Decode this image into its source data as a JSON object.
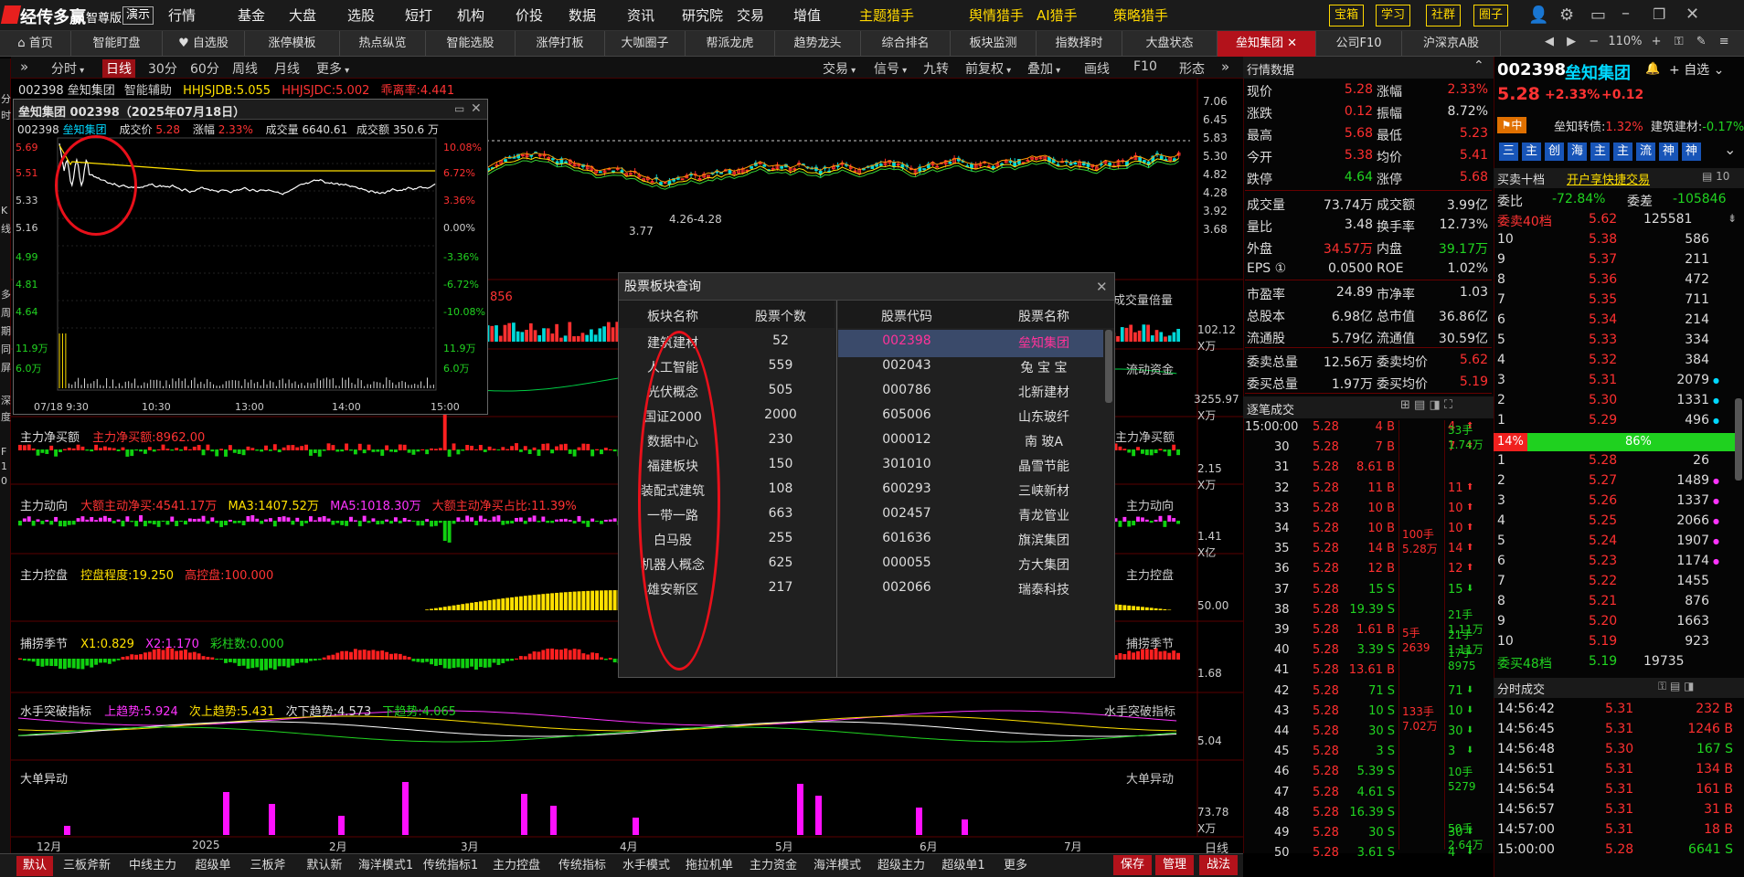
{
  "app": {
    "brand": "经传多赢",
    "edition": "智尊版",
    "demo": "演示",
    "menu": [
      "行情",
      "基金",
      "大盘",
      "选股",
      "短打",
      "机构",
      "价投",
      "数据",
      "资讯",
      "研究院",
      "交易",
      "增值"
    ],
    "menu_hl": [
      "主题猎手",
      "舆情猎手",
      "AI猎手",
      "策略猎手"
    ],
    "right_btns": [
      "宝箱",
      "学习",
      "社群",
      "圈子"
    ],
    "zoom": "110%"
  },
  "tabs": [
    "首页",
    "智能盯盘",
    "自选股",
    "涨停模板",
    "热点纵览",
    "智能选股",
    "涨停打板",
    "大咖圈子",
    "帮派龙虎",
    "趋势龙头",
    "综合排名",
    "板块监测",
    "指数择时",
    "大盘状态",
    "垒知集团",
    "公司F10",
    "沪深京A股"
  ],
  "toolbar": {
    "periods": [
      "分时",
      "日线",
      "30分",
      "60分",
      "周线",
      "月线",
      "更多"
    ],
    "right": [
      "交易",
      "信号",
      "九转",
      "前复权",
      "叠加",
      "画线",
      "F10",
      "形态"
    ],
    "active": "日线"
  },
  "chart": {
    "stock_line": "002398 垒知集团",
    "ind_label": "智能辅助",
    "ind1": "HHJSJDB:5.055",
    "ind2": "HHJSJDC:5.002",
    "ind3": "乖离率:4.441",
    "yaxis": [
      "7.06",
      "6.45",
      "5.83",
      "5.30",
      "4.82",
      "4.28",
      "3.92",
      "3.68"
    ],
    "low_label": "3.77",
    "range_label": "4.26-4.28",
    "vol_ind_val": "856",
    "vol_axis": [
      "102.12",
      "X万"
    ],
    "vol_label": "成交量倍量",
    "fund_label": "流动资金",
    "fund_axis": [
      "3255.97",
      "X万"
    ],
    "p3_title": "主力净买额",
    "p3_val": "主力净买额:8962.00",
    "p3_right": "主力净买额",
    "p3_axis": [
      "2.15",
      "X万"
    ],
    "p4_title": "主力动向",
    "p4_v1": "大额主动净买:4541.17万",
    "p4_v2": "MA3:1407.52万",
    "p4_v3": "MA5:1018.30万",
    "p4_v4": "大额主动净买占比:11.39%",
    "p4_right": "主力动向",
    "p4_axis": [
      "1.41",
      "X亿"
    ],
    "p5_title": "主力控盘",
    "p5_v1": "控盘程度:19.250",
    "p5_v2": "高控盘:100.000",
    "p5_right": "主力控盘",
    "p5_axis": "50.00",
    "p6_title": "捕捞季节",
    "p6_v1": "X1:0.829",
    "p6_v2": "X2:1.170",
    "p6_v3": "彩柱数:0.000",
    "p6_right": "捕捞季节",
    "p6_axis": "1.68",
    "p7_title": "水手突破指标",
    "p7_v1": "上趋势:5.924",
    "p7_v2": "次上趋势:5.431",
    "p7_v3": "次下趋势:4.573",
    "p7_v4": "下趋势:4.065",
    "p7_right": "水手突破指标",
    "p7_axis": "5.04",
    "p8_title": "大单异动",
    "p8_right": "大单异动",
    "p8_axis": [
      "73.78",
      "X万"
    ],
    "x_labels": [
      "12月",
      "2025",
      "2月",
      "3月",
      "4月",
      "5月",
      "6月",
      "7月"
    ],
    "x_right": "日线"
  },
  "mini": {
    "title": "垒知集团 002398（2025年07月18日）",
    "code": "002398",
    "name": "垒知集团",
    "price_label": "成交价",
    "price": "5.28",
    "chg_label": "涨幅",
    "chg": "2.33%",
    "vol_label": "成交量",
    "vol": "6640.61",
    "amt_label": "成交额",
    "amt": "350.6",
    "amt_unit": "万",
    "y_left": [
      "5.69",
      "5.51",
      "5.33",
      "5.16",
      "4.99",
      "4.81",
      "4.64",
      "11.9万",
      "6.0万"
    ],
    "y_right": [
      "10.08%",
      "6.72%",
      "3.36%",
      "0.00%",
      "-3.36%",
      "-6.72%",
      "-10.08%",
      "11.9万",
      "6.0万"
    ],
    "x": [
      "07/18 9:30",
      "10:30",
      "13:00",
      "14:00",
      "15:00"
    ]
  },
  "popup": {
    "title": "股票板块查询",
    "h1": "板块名称",
    "h2": "股票个数",
    "h3": "股票代码",
    "h4": "股票名称",
    "sectors": [
      [
        "建筑建材",
        "52"
      ],
      [
        "人工智能",
        "559"
      ],
      [
        "光伏概念",
        "505"
      ],
      [
        "国证2000",
        "2000"
      ],
      [
        "数据中心",
        "230"
      ],
      [
        "福建板块",
        "150"
      ],
      [
        "装配式建筑",
        "108"
      ],
      [
        "一带一路",
        "663"
      ],
      [
        "白马股",
        "255"
      ],
      [
        "机器人概念",
        "625"
      ],
      [
        "雄安新区",
        "217"
      ]
    ],
    "stocks": [
      [
        "002398",
        "垒知集团"
      ],
      [
        "002043",
        "兔 宝 宝"
      ],
      [
        "000786",
        "北新建材"
      ],
      [
        "605006",
        "山东玻纤"
      ],
      [
        "000012",
        "南 玻A"
      ],
      [
        "301010",
        "晶雪节能"
      ],
      [
        "600293",
        "三峡新材"
      ],
      [
        "002457",
        "青龙管业"
      ],
      [
        "601636",
        "旗滨集团"
      ],
      [
        "000055",
        "方大集团"
      ],
      [
        "002066",
        "瑞泰科技"
      ]
    ]
  },
  "quote": {
    "title": "行情数据",
    "rows": [
      [
        "现价",
        "5.28",
        "涨幅",
        "2.33%"
      ],
      [
        "涨跌",
        "0.12",
        "振幅",
        "8.72%"
      ],
      [
        "最高",
        "5.68",
        "最低",
        "5.23"
      ],
      [
        "今开",
        "5.38",
        "均价",
        "5.41"
      ],
      [
        "跌停",
        "4.64",
        "涨停",
        "5.68"
      ]
    ],
    "rows2": [
      [
        "成交量",
        "73.74万",
        "成交额",
        "3.99亿"
      ],
      [
        "量比",
        "3.48",
        "换手率",
        "12.73%"
      ],
      [
        "外盘",
        "34.57万",
        "内盘",
        "39.17万"
      ],
      [
        "EPS ①",
        "0.0500",
        "ROE",
        "1.02%"
      ]
    ],
    "rows3": [
      [
        "市盈率",
        "24.89",
        "市净率",
        "1.03"
      ],
      [
        "总股本",
        "6.98亿",
        "总市值",
        "36.86亿"
      ],
      [
        "流通股",
        "5.79亿",
        "流通值",
        "30.59亿"
      ]
    ],
    "rows4": [
      [
        "委卖总量",
        "12.56万",
        "委卖均价",
        "5.62"
      ],
      [
        "委买总量",
        "1.97万",
        "委买均价",
        "5.19"
      ]
    ]
  },
  "ticks": {
    "title": "逐笔成交",
    "rows": [
      [
        "15:00:00",
        "5.28",
        "4 B",
        "4",
        "",
        ""
      ],
      [
        "30",
        "5.28",
        "7 B",
        "7",
        "",
        ""
      ],
      [
        "31",
        "5.28",
        "8.61 B",
        "",
        "",
        ""
      ],
      [
        "32",
        "5.28",
        "11 B",
        "11",
        "",
        ""
      ],
      [
        "33",
        "5.28",
        "10 B",
        "10",
        "",
        ""
      ],
      [
        "34",
        "5.28",
        "10 B",
        "10",
        "",
        ""
      ],
      [
        "35",
        "5.28",
        "14 B",
        "14",
        "",
        ""
      ],
      [
        "36",
        "5.28",
        "12 B",
        "12",
        "",
        ""
      ],
      [
        "37",
        "5.28",
        "15 S",
        "15",
        "",
        ""
      ],
      [
        "38",
        "5.28",
        "19.39 S",
        "",
        "",
        ""
      ],
      [
        "39",
        "5.28",
        "1.61 B",
        "",
        "",
        ""
      ],
      [
        "40",
        "5.28",
        "3.39 S",
        "",
        "",
        ""
      ],
      [
        "41",
        "5.28",
        "13.61 B",
        "",
        "",
        ""
      ],
      [
        "42",
        "5.28",
        "71 S",
        "71",
        "",
        ""
      ],
      [
        "43",
        "5.28",
        "10 S",
        "10",
        "",
        ""
      ],
      [
        "44",
        "5.28",
        "30 S",
        "30",
        "",
        ""
      ],
      [
        "45",
        "5.28",
        "3 S",
        "3",
        "",
        ""
      ],
      [
        "46",
        "5.28",
        "5.39 S",
        "",
        "",
        ""
      ],
      [
        "47",
        "5.28",
        "4.61 S",
        "",
        "",
        ""
      ],
      [
        "48",
        "5.28",
        "16.39 S",
        "",
        "",
        ""
      ],
      [
        "49",
        "5.28",
        "30 S",
        "30",
        "",
        ""
      ],
      [
        "50",
        "5.28",
        "3.61 S",
        "4",
        "",
        ""
      ]
    ],
    "groups": [
      "33手",
      "1.74万",
      "100手",
      "5.28万",
      "5手",
      "2639",
      "133手",
      "7.02万",
      "21手",
      "1.11万",
      "21手",
      "1.11万",
      "17手",
      "8975",
      "10手",
      "5279",
      "50手",
      "2.64万"
    ]
  },
  "right": {
    "code": "002398",
    "name": "垒知集团",
    "self_sel": "自选",
    "price": "5.28",
    "chg": "+2.33%",
    "chg2": "+0.12",
    "cb_label": "垒知转债:",
    "cb_val": "1.32%",
    "sec_label": "建筑建材:",
    "sec_val": "-0.17%",
    "mid": "中",
    "icons": [
      "三",
      "主",
      "创",
      "海",
      "主",
      "主",
      "流",
      "神",
      "神"
    ],
    "ob_title": "买卖十档",
    "ob_link": "开户享快捷交易",
    "wb_label": "委比",
    "wb_val": "-72.84%",
    "wc_label": "委差",
    "wc_val": "-105846",
    "ask40_label": "委卖40档",
    "ask40_price": "5.62",
    "ask40_vol": "125581",
    "asks": [
      [
        "10",
        "5.38",
        "586"
      ],
      [
        "9",
        "5.37",
        "211"
      ],
      [
        "8",
        "5.36",
        "472"
      ],
      [
        "7",
        "5.35",
        "711"
      ],
      [
        "6",
        "5.34",
        "214"
      ],
      [
        "5",
        "5.33",
        "334"
      ],
      [
        "4",
        "5.32",
        "384"
      ],
      [
        "3",
        "5.31",
        "2079"
      ],
      [
        "2",
        "5.30",
        "1331"
      ],
      [
        "1",
        "5.29",
        "496"
      ]
    ],
    "bar_l": "14%",
    "bar_r": "86%",
    "bar_frac": 0.14,
    "bids": [
      [
        "1",
        "5.28",
        "26"
      ],
      [
        "2",
        "5.27",
        "1489"
      ],
      [
        "3",
        "5.26",
        "1337"
      ],
      [
        "4",
        "5.25",
        "2066"
      ],
      [
        "5",
        "5.24",
        "1907"
      ],
      [
        "6",
        "5.23",
        "1174"
      ],
      [
        "7",
        "5.22",
        "1455"
      ],
      [
        "8",
        "5.21",
        "876"
      ],
      [
        "9",
        "5.20",
        "1663"
      ],
      [
        "10",
        "5.19",
        "923"
      ]
    ],
    "bid48_label": "委买48档",
    "bid48_price": "5.19",
    "bid48_vol": "19735",
    "fs_title": "分时成交",
    "fs": [
      [
        "14:56:42",
        "5.31",
        "232 B"
      ],
      [
        "14:56:45",
        "5.31",
        "1246 B"
      ],
      [
        "14:56:48",
        "5.30",
        "167 S"
      ],
      [
        "14:56:51",
        "5.31",
        "134 B"
      ],
      [
        "14:56:54",
        "5.31",
        "161 B"
      ],
      [
        "14:56:57",
        "5.31",
        "31 B"
      ],
      [
        "14:57:00",
        "5.31",
        "18 B"
      ],
      [
        "15:00:00",
        "5.28",
        "6641 S"
      ]
    ]
  },
  "bottom": {
    "tabs": [
      "默认",
      "三板斧新",
      "中线主力",
      "超级单",
      "三板斧",
      "默认新",
      "海洋模式1",
      "传统指标1",
      "主力控盘",
      "传统指标",
      "水手模式",
      "拖拉机单",
      "主力资金",
      "海洋模式",
      "超级主力",
      "超级单1",
      "更多"
    ],
    "right": [
      "保存",
      "管理",
      "战法"
    ]
  },
  "sidebar_left": [
    "分",
    "时",
    "K",
    "线",
    "多",
    "周",
    "期",
    "同",
    "屏",
    "深",
    "度",
    "F",
    "1",
    "0"
  ]
}
